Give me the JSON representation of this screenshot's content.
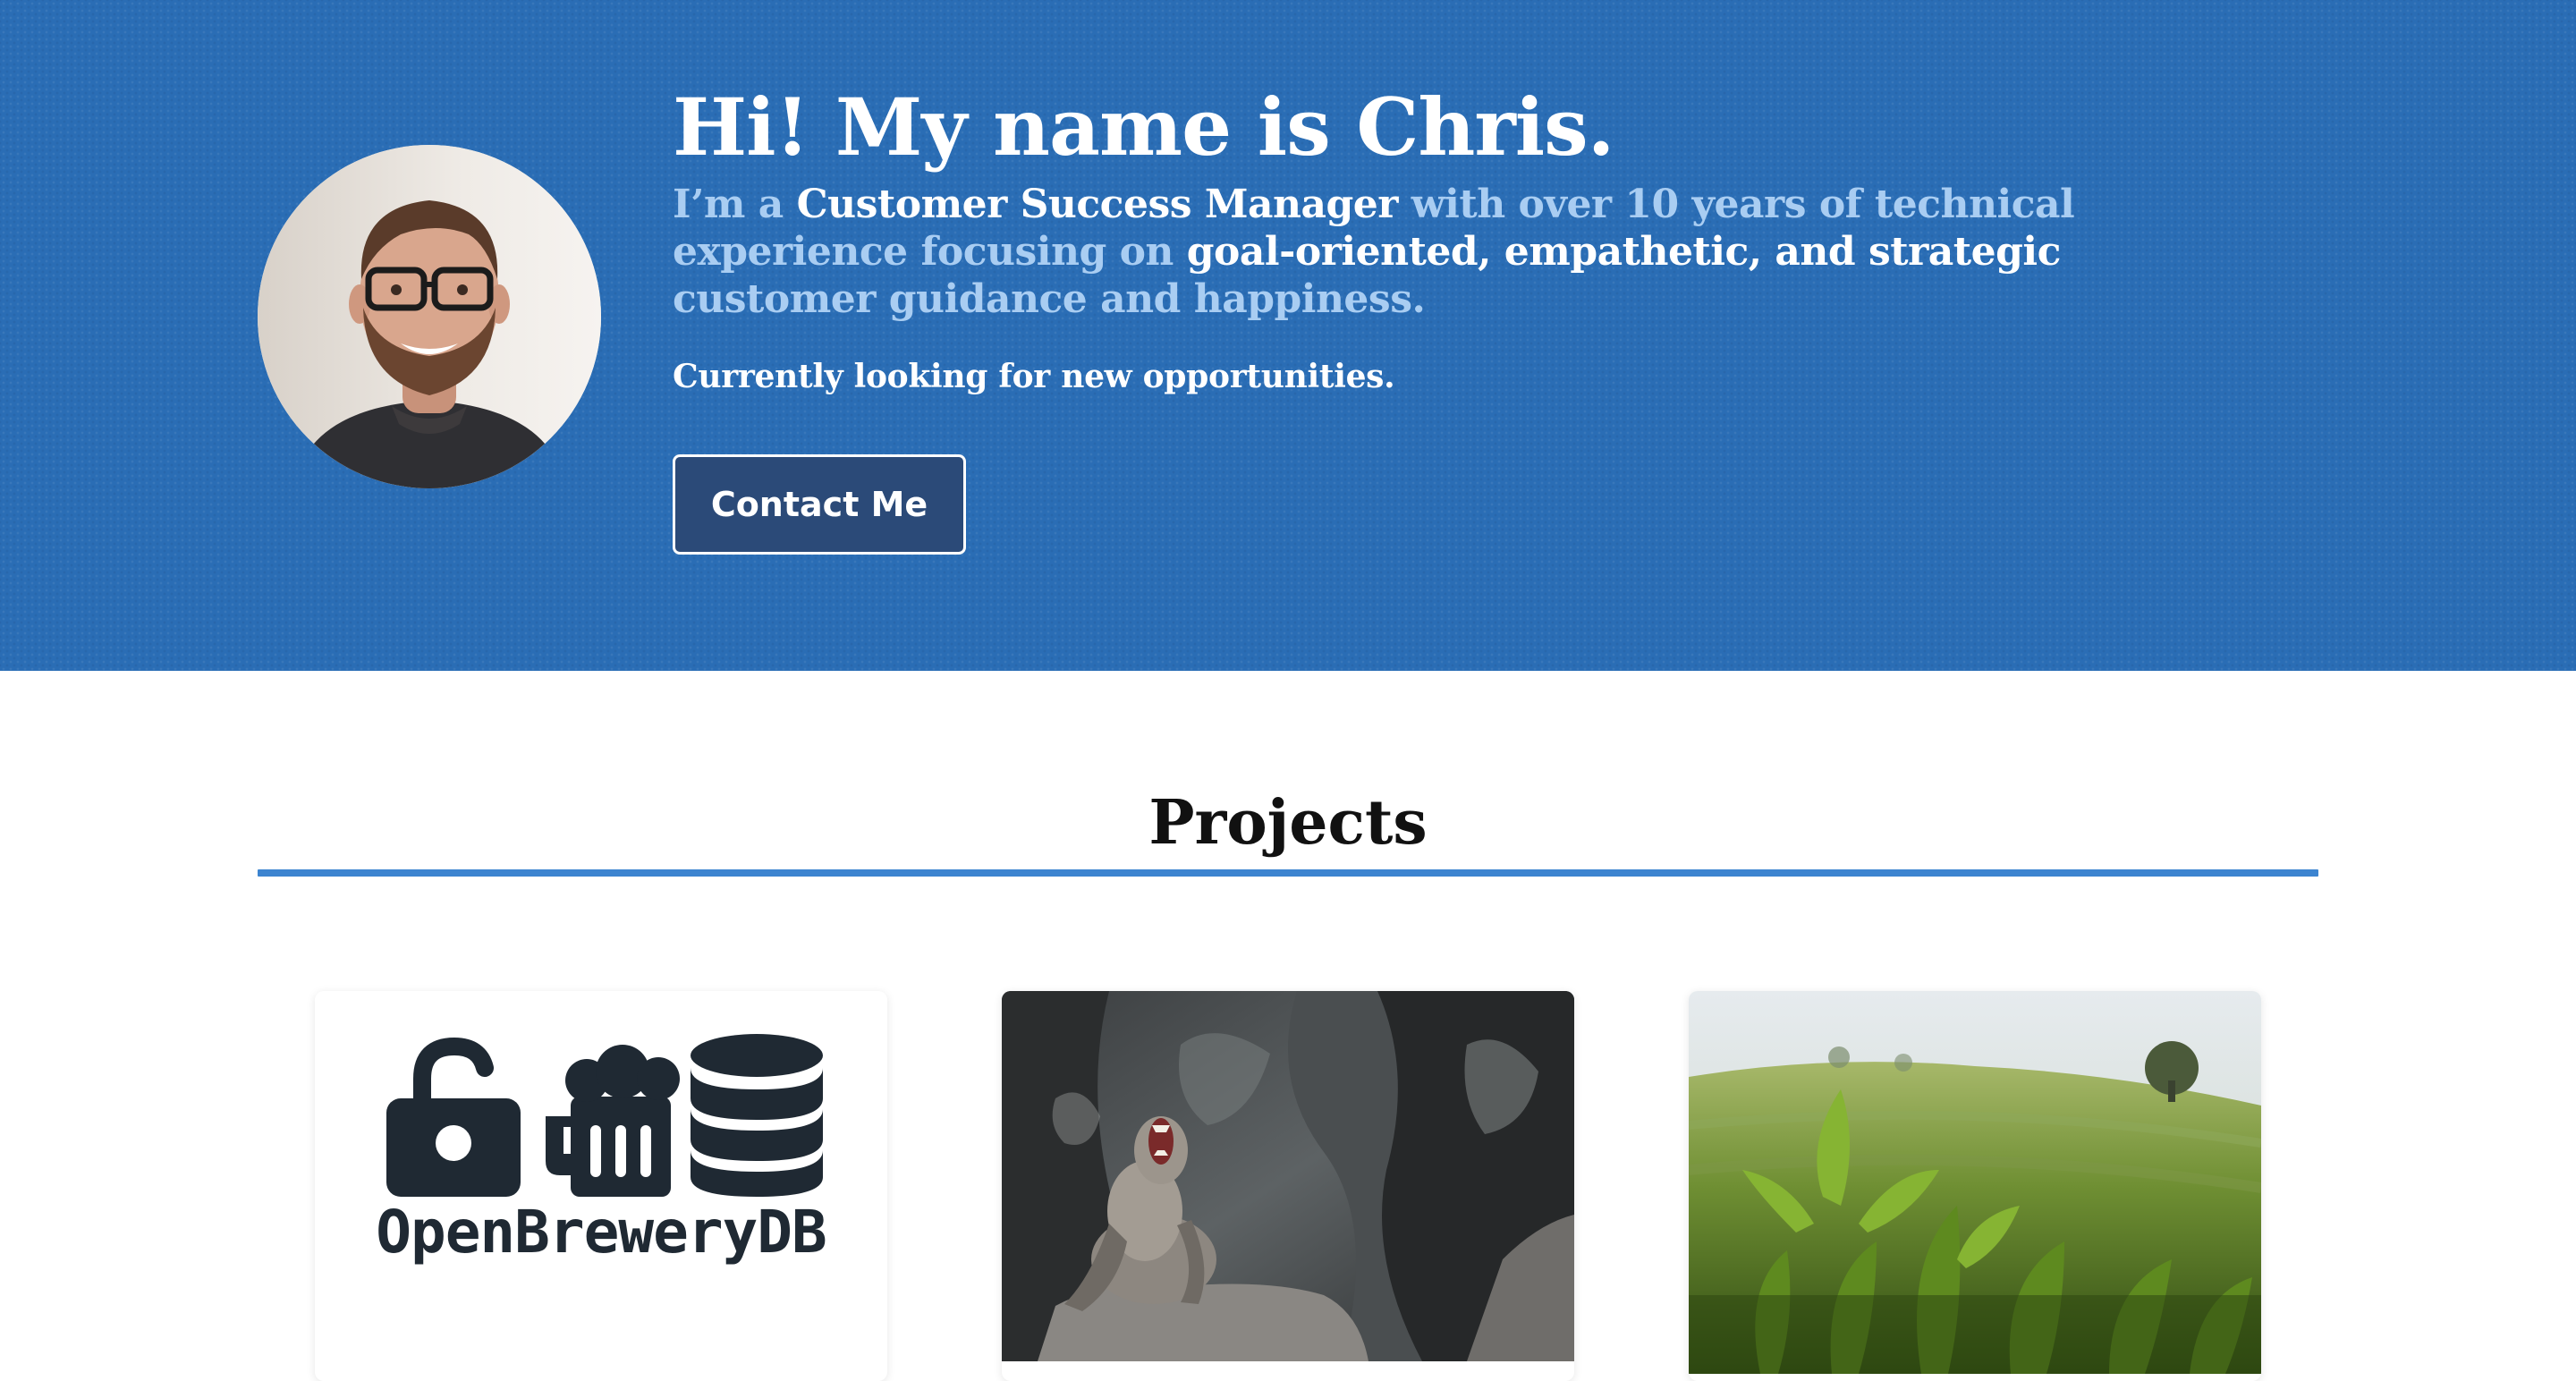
{
  "hero": {
    "title": "Hi! My name is Chris.",
    "intro": {
      "p1": "I’m a ",
      "role": "Customer Success Manager",
      "p2": " with over 10 years of technical experience focusing on ",
      "qualities": "goal-oriented, empathetic, and strategic",
      "p3": " customer guidance and happiness."
    },
    "status": "Currently looking for new opportunities.",
    "contact_button": "Contact Me"
  },
  "projects": {
    "heading": "Projects",
    "cards": [
      {
        "logo_text": "OpenBreweryDB",
        "icons": [
          "unlock-icon",
          "beer-mug-icon",
          "database-icon"
        ]
      },
      {
        "image": "monkey-yawning-photo"
      },
      {
        "image": "tea-plantation-photo"
      }
    ]
  },
  "colors": {
    "hero_background": "#2a6db5",
    "hero_highlight": "#a9cdf2",
    "button_background": "#2b4a78",
    "rule": "#3c84d0",
    "logo_dark": "#1f2933"
  }
}
